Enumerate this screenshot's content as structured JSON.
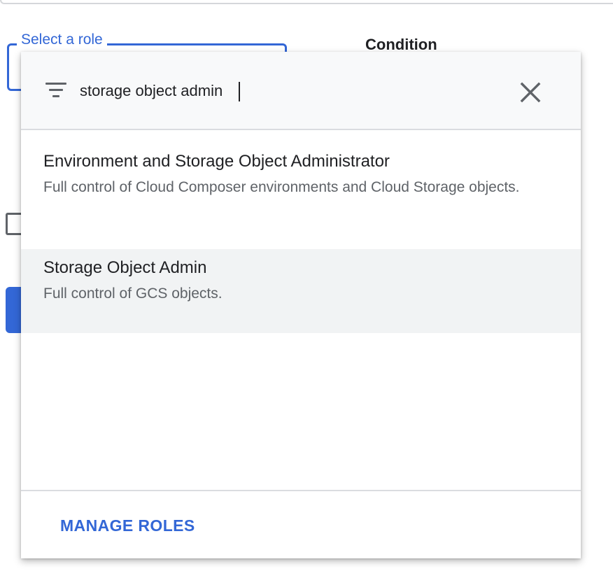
{
  "background": {
    "role_field_label": "Select a role",
    "condition_label": "Condition"
  },
  "dropdown": {
    "search": {
      "value": "storage object admin",
      "filter_icon": "filter-list-icon",
      "clear_icon": "close-icon"
    },
    "options": [
      {
        "title": "Environment and Storage Object Administrator",
        "description": "Full control of Cloud Composer environments and Cloud Storage objects."
      },
      {
        "title": "Storage Object Admin",
        "description": "Full control of GCS objects."
      }
    ],
    "footer": {
      "manage_roles_label": "MANAGE ROLES"
    }
  },
  "colors": {
    "accent": "#3367d6",
    "hover_row": "#f1f3f4",
    "secondary_text": "#5f6368",
    "primary_text": "#202124"
  }
}
